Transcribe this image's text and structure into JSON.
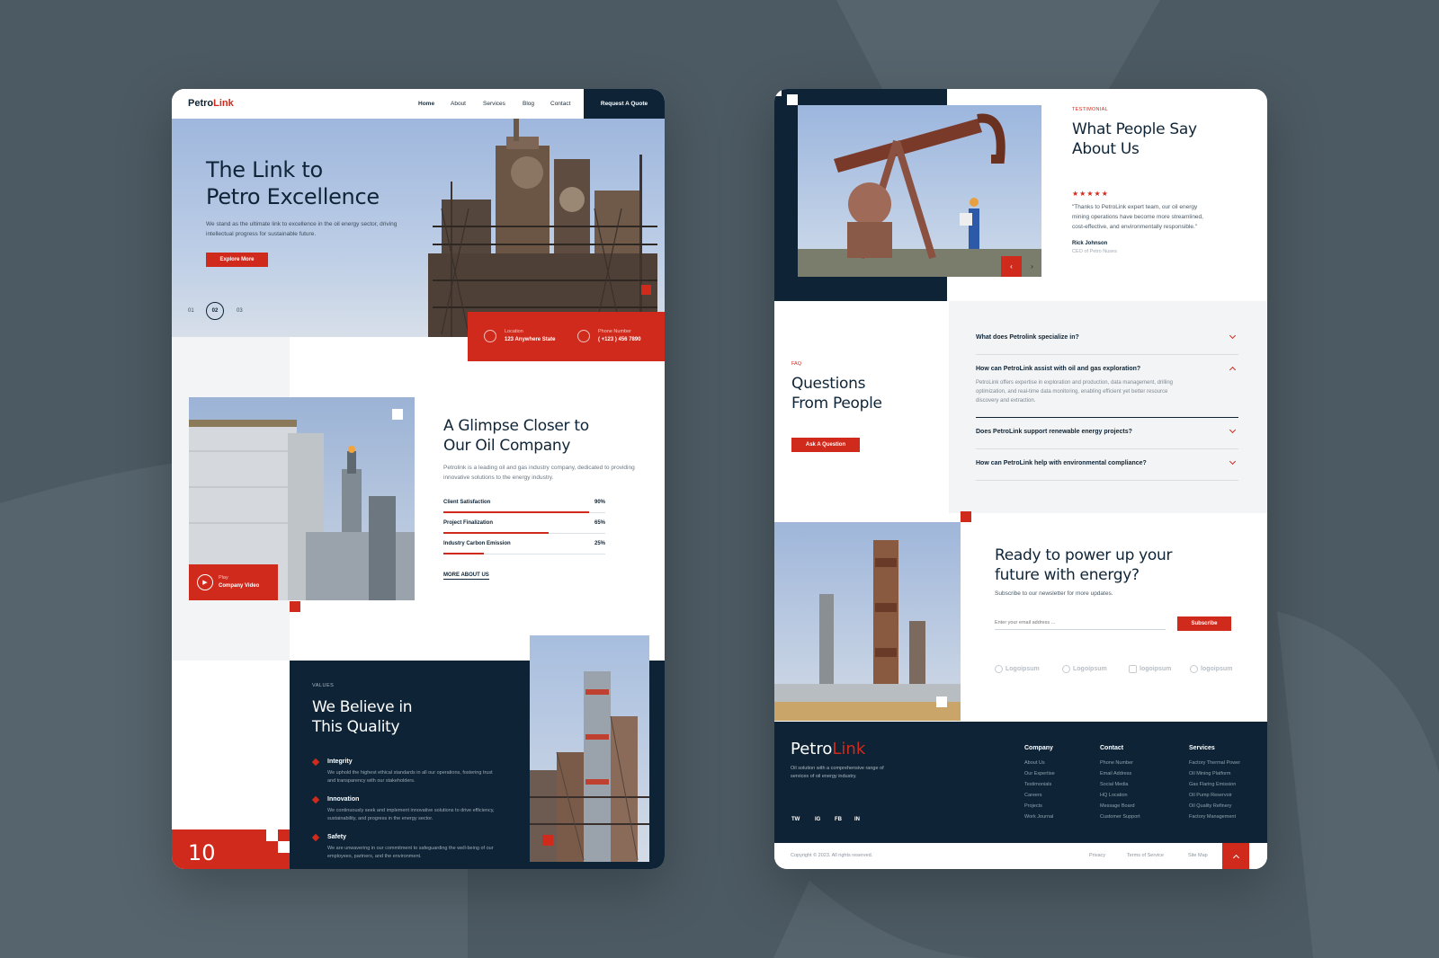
{
  "brand": {
    "name_part1": "Petro",
    "name_part2": "Link",
    "accent": "#cf2a1c",
    "navy": "#0e2436"
  },
  "nav": {
    "items": [
      "Home",
      "About",
      "Services",
      "Blog",
      "Contact"
    ],
    "cta": "Request A Quote"
  },
  "hero": {
    "title_line1": "The Link to",
    "title_line2": "Petro Excellence",
    "subtitle": "We stand as the ultimate link to excellence in the oil energy sector, driving intellectual progress for sustainable future.",
    "button": "Explore More",
    "slides": [
      "01",
      "02",
      "03"
    ],
    "active_slide": "02"
  },
  "contact_strip": {
    "location_label": "Location",
    "location_value": "123 Anywhere State",
    "phone_label": "Phone Number",
    "phone_value": "( +123 ) 456 7890"
  },
  "about": {
    "title_line1": "A Glimpse Closer to",
    "title_line2": "Our Oil Company",
    "text": "Petrolink is a leading oil and gas industry company, dedicated to providing innovative solutions to the energy industry.",
    "video_label1": "Play",
    "video_label2": "Company Video",
    "link": "MORE ABOUT US",
    "stats": [
      {
        "label": "Client Satisfaction",
        "display": "90%",
        "value": 90
      },
      {
        "label": "Project Finalization",
        "display": "65%",
        "value": 65
      },
      {
        "label": "Industry Carbon Emission",
        "display": "25%",
        "value": 25
      }
    ]
  },
  "values": {
    "eyebrow": "VALUES",
    "title_line1": "We Believe in",
    "title_line2": "This Quality",
    "counter": "10",
    "items": [
      {
        "title": "Integrity",
        "text": "We uphold the highest ethical standards in all our operations, fostering trust and transparency with our stakeholders."
      },
      {
        "title": "Innovation",
        "text": "We continuously seek and implement innovative solutions to drive efficiency, sustainability, and progress in the energy sector."
      },
      {
        "title": "Safety",
        "text": "We are unwavering in our commitment to safeguarding the well-being of our employees, partners, and the environment."
      }
    ]
  },
  "testimonial": {
    "eyebrow": "TESTIMONIAL",
    "title_line1": "What People Say",
    "title_line2": "About Us",
    "stars": "★★★★★",
    "quote": "\"Thanks to PetroLink expert team, our oil energy mining operations have become more streamlined, cost-effective, and environmentally responsible.\"",
    "author": "Rick Johnson",
    "role": "CEO of Petro Nuses"
  },
  "faq": {
    "eyebrow": "FAQ",
    "title_line1": "Questions",
    "title_line2": "From People",
    "button": "Ask A Question",
    "items": [
      {
        "q": "What does Petrolink specialize in?",
        "a": ""
      },
      {
        "q": "How can PetroLink assist with oil and gas exploration?",
        "a": "PetroLink offers expertise in exploration and production, data management, drilling optimization, and real-time data monitoring, enabling efficient yet better resource discovery and extraction."
      },
      {
        "q": "Does PetroLink support renewable energy projects?",
        "a": ""
      },
      {
        "q": "How can PetroLink help with environmental compliance?",
        "a": ""
      }
    ]
  },
  "newsletter": {
    "title_line1": "Ready to power up your",
    "title_line2": "future with energy?",
    "subtitle": "Subscribe to our newsletter for more updates.",
    "placeholder": "Enter your email address ...",
    "button": "Subscribe",
    "logos": [
      "Logoipsum",
      "Logoipsum",
      "logoipsum",
      "logoipsum"
    ]
  },
  "footer": {
    "tagline": "Oil solution with a comprehensive range of services of oil energy industry.",
    "social": [
      "TW",
      "IG",
      "FB",
      "IN"
    ],
    "columns": [
      {
        "title": "Company",
        "links": [
          "About Us",
          "Our Expertise",
          "Testimonials",
          "Careers",
          "Projects",
          "Work Journal"
        ]
      },
      {
        "title": "Contact",
        "links": [
          "Phone Number",
          "Email Address",
          "Social Media",
          "HQ Location",
          "Message Board",
          "Customer Support"
        ]
      },
      {
        "title": "Services",
        "links": [
          "Factory Thermal Power",
          "Oil Mining Platform",
          "Gas Flaring Emission",
          "Oil Pump Reservoir",
          "Oil Quality Refinery",
          "Factory Management"
        ]
      }
    ],
    "copyright": "Copyright © 2023. All rights reserved.",
    "bottom_links": [
      "Privacy",
      "Terms of Service",
      "Site Map"
    ]
  }
}
